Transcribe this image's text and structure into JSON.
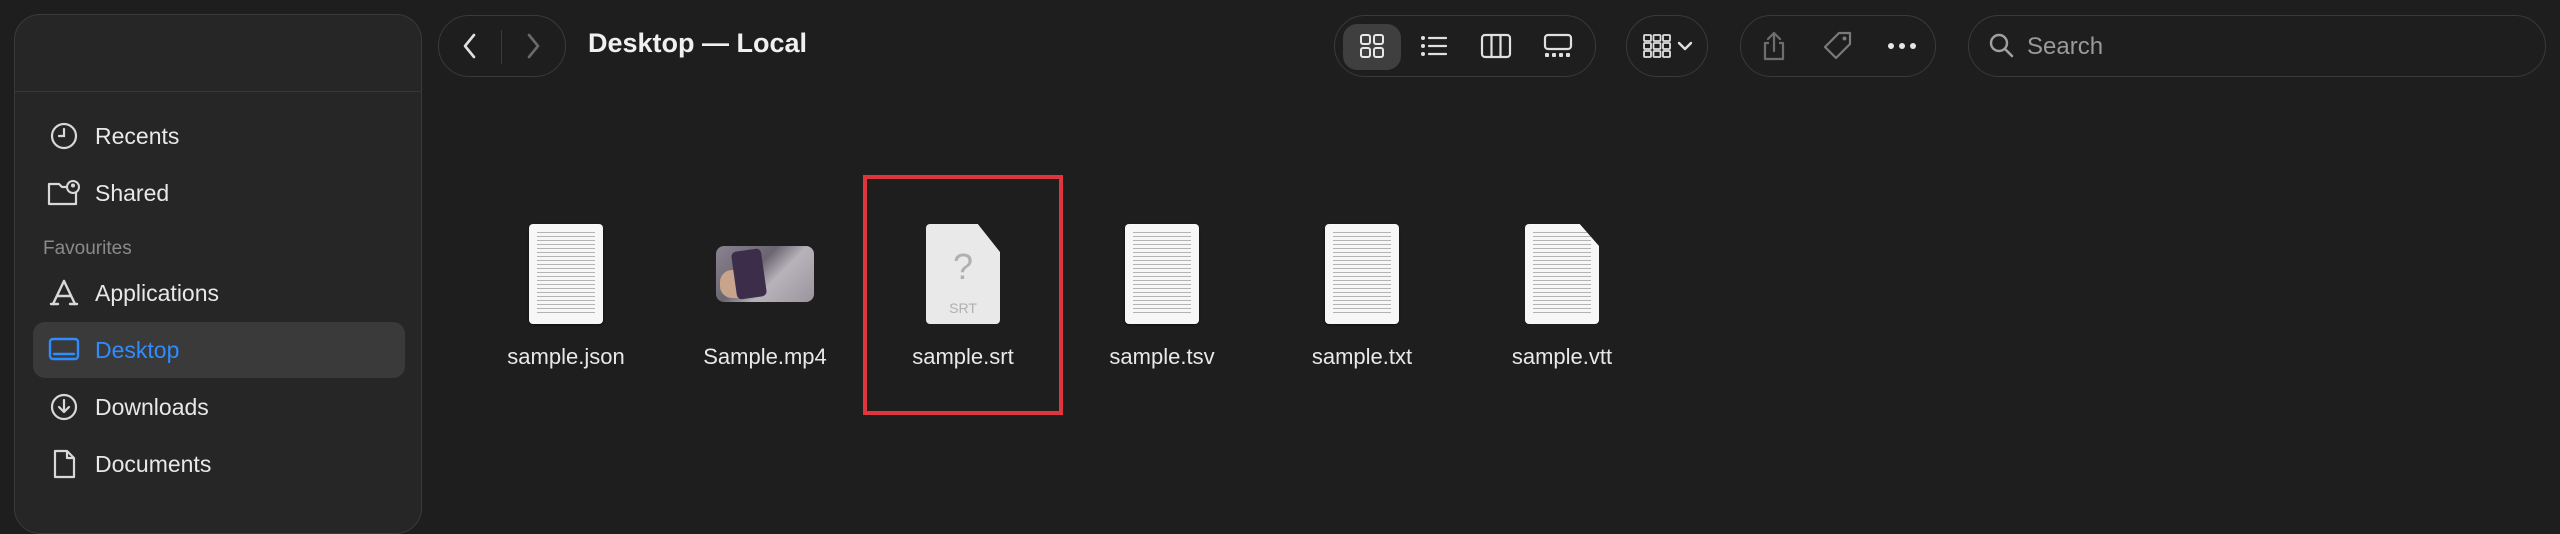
{
  "window": {
    "title": "Desktop — Local"
  },
  "sidebar": {
    "items_top": [
      {
        "label": "Recents",
        "icon": "clock-icon"
      },
      {
        "label": "Shared",
        "icon": "shared-folder-icon"
      }
    ],
    "section_label": "Favourites",
    "items_fav": [
      {
        "label": "Applications",
        "icon": "applications-icon"
      },
      {
        "label": "Desktop",
        "icon": "desktop-icon",
        "active": true
      },
      {
        "label": "Downloads",
        "icon": "downloads-icon"
      },
      {
        "label": "Documents",
        "icon": "documents-icon"
      }
    ]
  },
  "toolbar": {
    "view_modes": [
      "icon-view",
      "list-view",
      "column-view",
      "gallery-view"
    ],
    "active_view": "icon-view"
  },
  "search": {
    "placeholder": "Search",
    "value": ""
  },
  "files": [
    {
      "name": "sample.json",
      "kind": "text-doc"
    },
    {
      "name": "Sample.mp4",
      "kind": "video"
    },
    {
      "name": "sample.srt",
      "kind": "unknown",
      "ext_label": "SRT",
      "selected": true
    },
    {
      "name": "sample.tsv",
      "kind": "text-doc"
    },
    {
      "name": "sample.txt",
      "kind": "text-doc"
    },
    {
      "name": "sample.vtt",
      "kind": "text-doc-folded"
    }
  ],
  "colors": {
    "accent": "#2f8cff",
    "highlight_box": "#e0353d",
    "background": "#1e1e1e",
    "sidebar": "#262626"
  }
}
